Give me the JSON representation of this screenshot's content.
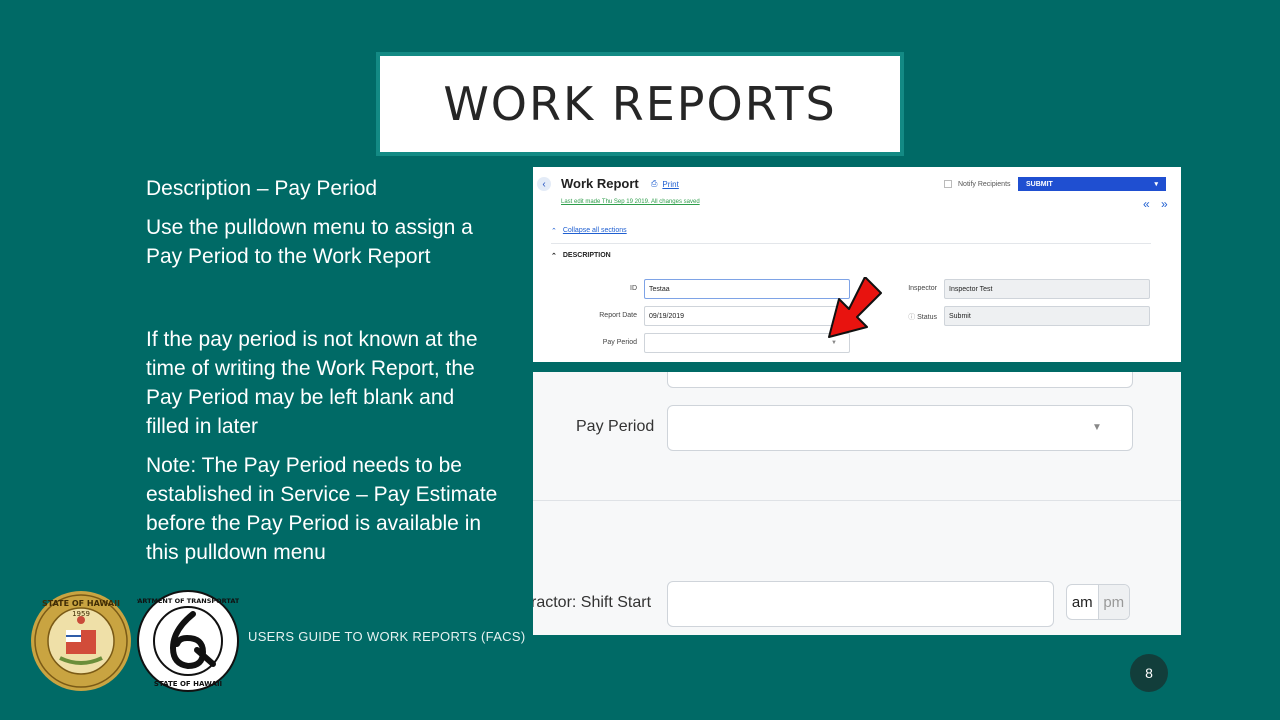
{
  "slide": {
    "title": "WORK REPORTS",
    "paragraphs": [
      "Description – Pay Period",
      "Use the pulldown menu to assign a Pay Period to the Work Report",
      "If the pay period is not known at the time of writing the Work Report, the Pay Period may be left blank and filled in later",
      "Note: The Pay Period needs to be established in Service – Pay Estimate before the Pay Period is available in this pulldown menu"
    ],
    "footer": "USERS GUIDE TO WORK REPORTS  (FACS)",
    "page_number": "8",
    "seal_text": "STATE OF HAWAII",
    "seal_year": "1959",
    "dot_logo_top": "DEPARTMENT OF TRANSPORTATION",
    "dot_logo_bottom": "STATE OF HAWAII"
  },
  "screenshot_top": {
    "title": "Work Report",
    "print": "Print",
    "last_edit": "Last edit made Thu Sep 19 2019. All changes saved",
    "notify": "Notify Recipients",
    "submit": "SUBMIT",
    "nav_arrows": "« »",
    "collapse": "Collapse all sections",
    "section": "DESCRIPTION",
    "fields": {
      "id_label": "ID",
      "id_value": "Testaa",
      "report_date_label": "Report Date",
      "report_date_value": "09/19/2019",
      "pay_period_label": "Pay Period",
      "pay_period_value": "",
      "inspector_label": "Inspector",
      "inspector_value": "Inspector Test",
      "status_label": "Status",
      "status_value": "Submit"
    }
  },
  "screenshot_zoom": {
    "pay_period_label": "Pay Period",
    "shift_start_label": "ractor: Shift Start",
    "am": "am",
    "pm": "pm"
  },
  "colors": {
    "background": "#006a66",
    "title_border": "#138a84",
    "submit": "#1f4fd1",
    "arrow": "#e8130f"
  }
}
